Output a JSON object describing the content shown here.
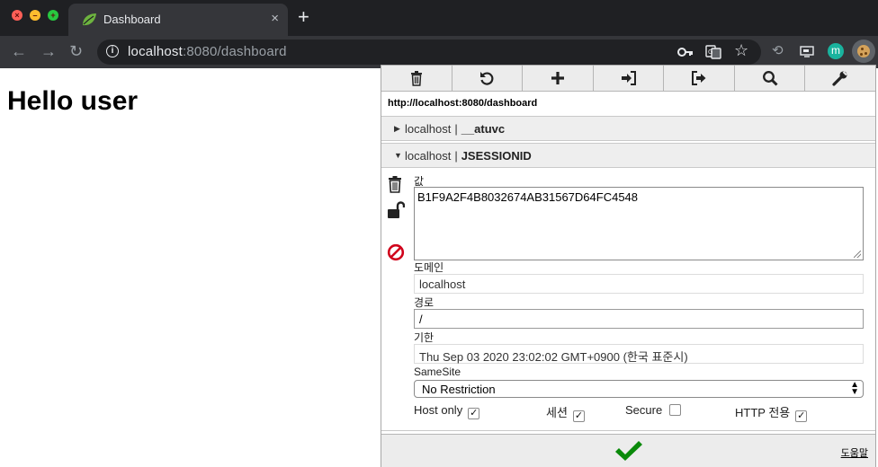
{
  "browser": {
    "tab_title": "Dashboard",
    "tab_close": "×",
    "new_tab": "+",
    "url_host": "localhost",
    "url_rest": ":8080/dashboard",
    "ext_m_label": "m"
  },
  "page": {
    "heading": "Hello user"
  },
  "popup": {
    "url": "http://localhost:8080/dashboard",
    "cookies": [
      {
        "domain": "localhost",
        "separator": "|",
        "name": "__atuvc",
        "expanded": false,
        "arrow": "▶"
      },
      {
        "domain": "localhost",
        "separator": "|",
        "name": "JSESSIONID",
        "expanded": true,
        "arrow": "▼"
      }
    ],
    "detail": {
      "value_label": "값",
      "value": "B1F9A2F4B8032674AB31567D64FC4548",
      "domain_label": "도메인",
      "domain": "localhost",
      "path_label": "경로",
      "path": "/",
      "expires_label": "기한",
      "expires": "Thu Sep 03 2020 23:02:02 GMT+0900 (한국 표준시)",
      "samesite_label": "SameSite",
      "samesite_value": "No Restriction",
      "host_only_label": "Host only",
      "session_label": "세션",
      "secure_label": "Secure",
      "http_only_label": "HTTP 전용",
      "check_mark": "✓"
    },
    "help_label": "도움말"
  },
  "colors": {
    "accent_green": "#0a8a0a",
    "block_red": "#d0021b"
  }
}
